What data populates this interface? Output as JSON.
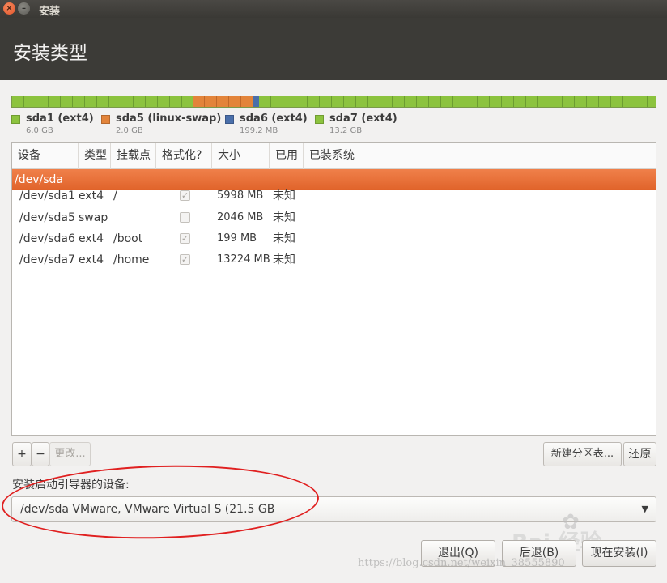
{
  "window": {
    "title": "安装",
    "close_glyph": "×",
    "minimize_glyph": "–"
  },
  "page": {
    "title": "安装类型"
  },
  "disk_bar": {
    "segments": [
      {
        "name": "sda1",
        "size_gb": 6.0,
        "color": "#8cc33e"
      },
      {
        "name": "sda5",
        "size_gb": 2.0,
        "color": "#e3843a"
      },
      {
        "name": "sda6",
        "size_gb": 0.1992,
        "color": "#4a6faa"
      },
      {
        "name": "sda7",
        "size_gb": 13.2,
        "color": "#8cc33e"
      }
    ]
  },
  "legend": [
    {
      "name": "sda1 (ext4)",
      "size": "6.0 GB",
      "color": "#8cc33e"
    },
    {
      "name": "sda5 (linux-swap)",
      "size": "2.0 GB",
      "color": "#e3843a"
    },
    {
      "name": "sda6 (ext4)",
      "size": "199.2 MB",
      "color": "#4a6faa"
    },
    {
      "name": "sda7 (ext4)",
      "size": "13.2 GB",
      "color": "#8cc33e"
    }
  ],
  "table": {
    "headers": [
      "设备",
      "类型",
      "挂载点",
      "格式化?",
      "大小",
      "已用",
      "已装系统"
    ],
    "disk_row": {
      "device": "/dev/sda"
    },
    "rows": [
      {
        "device": "/dev/sda1",
        "type": "ext4",
        "mount": "/",
        "format": true,
        "size": "5998 MB",
        "used": "未知",
        "system": ""
      },
      {
        "device": "/dev/sda5",
        "type": "swap",
        "mount": "",
        "format": false,
        "size": "2046 MB",
        "used": "未知",
        "system": ""
      },
      {
        "device": "/dev/sda6",
        "type": "ext4",
        "mount": "/boot",
        "format": true,
        "size": "199 MB",
        "used": "未知",
        "system": ""
      },
      {
        "device": "/dev/sda7",
        "type": "ext4",
        "mount": "/home",
        "format": true,
        "size": "13224 MB",
        "used": "未知",
        "system": ""
      }
    ],
    "check_glyph": "✓"
  },
  "toolbar": {
    "add": "+",
    "remove": "−",
    "change": "更改...",
    "new_table": "新建分区表...",
    "revert": "还原"
  },
  "boot_loader": {
    "label": "安装启动引导器的设备:",
    "selected": "/dev/sda   VMware, VMware Virtual S (21.5 GB",
    "arrow": "▼"
  },
  "buttons": {
    "quit": "退出(Q)",
    "back": "后退(B)",
    "install": "现在安装(I)"
  },
  "watermark": {
    "url": "https://blog.csdn.net/weixin_38555890",
    "baidu": "Bai  经验",
    "paw": "✿"
  },
  "colors": {
    "selection": "#e9692f",
    "header_bg": "#3c3b37",
    "annotation": "#e02020"
  }
}
